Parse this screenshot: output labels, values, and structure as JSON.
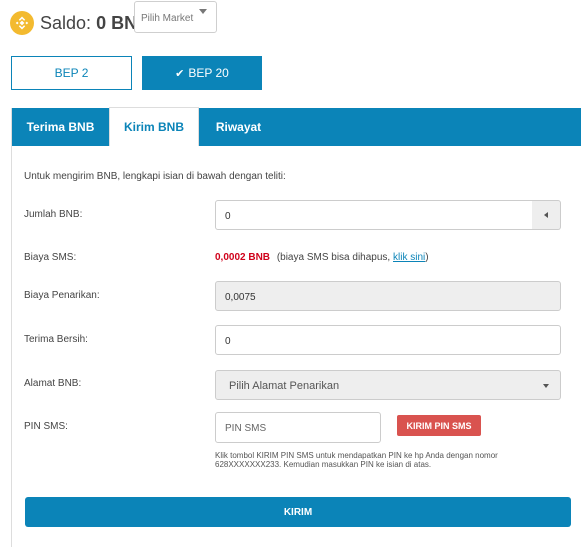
{
  "header": {
    "saldo_label": "Saldo:",
    "saldo_value": "0 BNB",
    "market_select_value": "Pilih Market"
  },
  "network": {
    "bep2_label": "BEP 2",
    "bep20_label": "BEP 20",
    "selected": "BEP 20"
  },
  "tabs": {
    "terima": "Terima BNB",
    "kirim": "Kirim BNB",
    "riwayat": "Riwayat",
    "active": "Kirim BNB"
  },
  "form": {
    "intro": "Untuk mengirim BNB, lengkapi isian di bawah dengan teliti:",
    "jumlah_label": "Jumlah BNB:",
    "jumlah_value": "0",
    "biaya_sms_label": "Biaya SMS:",
    "biaya_sms_value": "0,0002 BNB",
    "biaya_sms_note_prefix": "(biaya SMS bisa dihapus,",
    "biaya_sms_link": "klik sini",
    "biaya_sms_note_suffix": ")",
    "biaya_penarikan_label": "Biaya Penarikan:",
    "biaya_penarikan_value": "0,0075",
    "terima_bersih_label": "Terima Bersih:",
    "terima_bersih_value": "0",
    "alamat_label": "Alamat BNB:",
    "alamat_placeholder": "Pilih Alamat Penarikan",
    "pin_label": "PIN SMS:",
    "pin_placeholder": "PIN SMS",
    "pin_button": "KIRIM PIN SMS",
    "pin_help": "Klik tombol KIRIM PIN SMS untuk mendapatkan PIN ke hp Anda dengan nomor 628XXXXXXX233. Kemudian masukkan PIN ke isian di atas.",
    "submit_label": "KIRIM"
  },
  "colors": {
    "primary": "#0b84b8",
    "danger": "#d9534f",
    "fee_red": "#d0021b",
    "bnb_yellow": "#f3ba2f"
  },
  "icons": {
    "coin": "bnb-logo-icon",
    "check": "check-icon",
    "dropdown": "caret-down-icon",
    "addon": "caret-left-icon"
  }
}
